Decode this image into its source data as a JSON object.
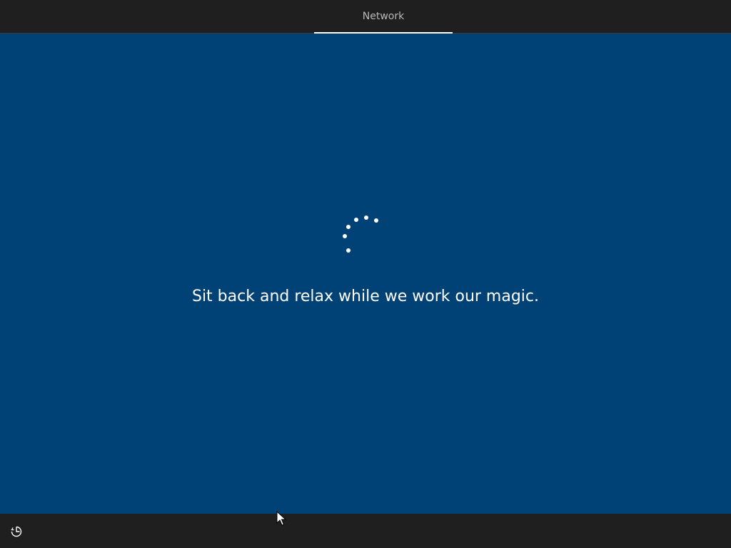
{
  "header": {
    "active_tab": "Network"
  },
  "main": {
    "message": "Sit back and relax while we work our magic.",
    "status_icon": "loading-spinner",
    "background_color": "#004275"
  },
  "footer": {
    "ease_of_access_icon": "ease-of-access-icon"
  },
  "colors": {
    "bar_background": "#1f1f1f",
    "tab_text": "#b9b9b9",
    "accent": "#ffffff"
  }
}
